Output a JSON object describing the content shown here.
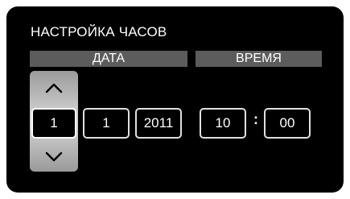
{
  "title": "НАСТРОЙКА ЧАСОВ",
  "headers": {
    "date": "ДАТА",
    "time": "ВРЕМЯ"
  },
  "date": {
    "day": "1",
    "month": "1",
    "year": "2011"
  },
  "time": {
    "hour": "10",
    "separator": ":",
    "minute": "00"
  },
  "icons": {
    "up": "chevron-up-icon",
    "down": "chevron-down-icon"
  },
  "colors": {
    "background": "#000000",
    "header_bar": "#5c5c5c",
    "text": "#ffffff",
    "spinner": "#d2d2d2"
  }
}
